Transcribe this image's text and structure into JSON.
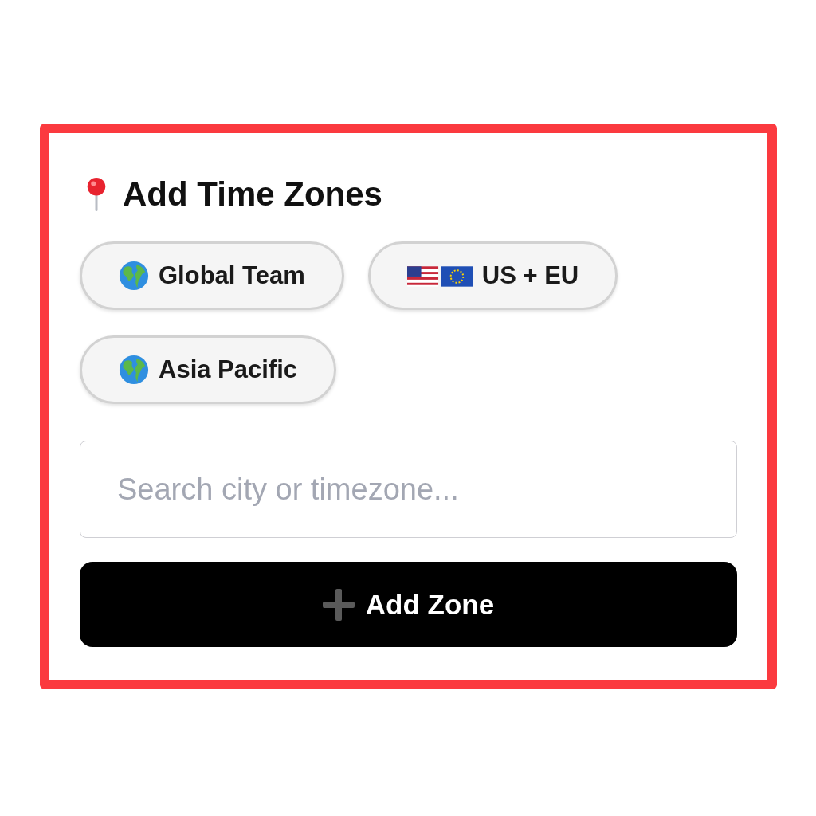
{
  "title": "Add Time Zones",
  "presets": [
    {
      "label": "Global Team",
      "kind": "globe"
    },
    {
      "label": "US + EU",
      "kind": "flags"
    },
    {
      "label": "Asia Pacific",
      "kind": "globe"
    }
  ],
  "search": {
    "placeholder": "Search city or timezone..."
  },
  "add_button": {
    "label": "Add Zone"
  }
}
